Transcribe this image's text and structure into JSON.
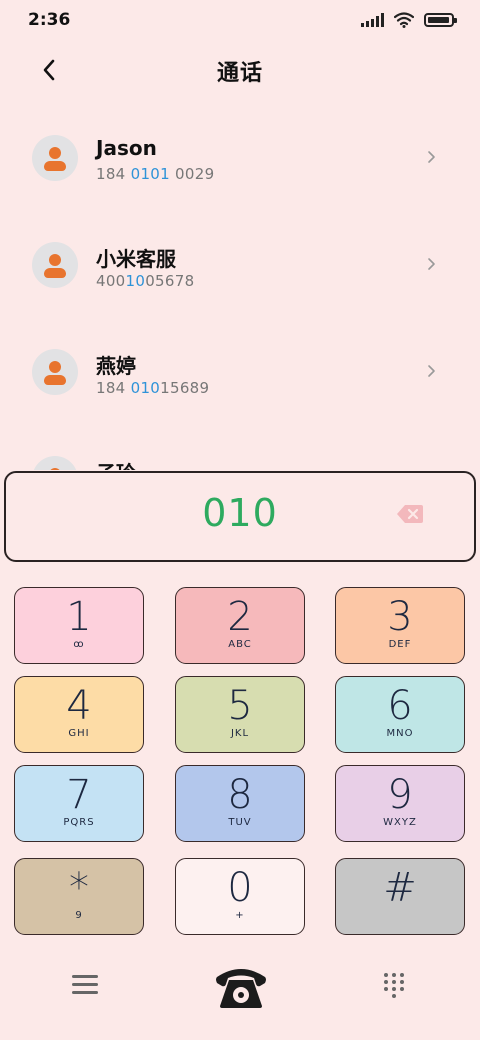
{
  "status_bar": {
    "time": "2:36"
  },
  "header": {
    "title": "通话",
    "back_icon": "chevron-left-icon"
  },
  "contacts": [
    {
      "name": "Jason",
      "number_parts": [
        "184 ",
        "0101",
        " 0029"
      ]
    },
    {
      "name": "小米客服",
      "number_parts": [
        "400",
        "10",
        "05678"
      ]
    },
    {
      "name": "燕婷",
      "number_parts": [
        "184 ",
        "010",
        "15689"
      ]
    },
    {
      "name": "子玲",
      "number_parts": [
        "",
        "",
        ""
      ]
    }
  ],
  "dial_input": {
    "value": "010",
    "color": "#2eaa5f",
    "backspace_icon": "backspace-icon"
  },
  "keypad": [
    {
      "digit": "1",
      "letters": "ꝏ",
      "color": "#fdd0dc"
    },
    {
      "digit": "2",
      "letters": "ABC",
      "color": "#f6b9bb"
    },
    {
      "digit": "3",
      "letters": "DEF",
      "color": "#fcc7a6"
    },
    {
      "digit": "4",
      "letters": "GHI",
      "color": "#fddca6"
    },
    {
      "digit": "5",
      "letters": "JKL",
      "color": "#d7ddb0"
    },
    {
      "digit": "6",
      "letters": "MNO",
      "color": "#bfe6e6"
    },
    {
      "digit": "7",
      "letters": "PQRS",
      "color": "#c4e2f4"
    },
    {
      "digit": "8",
      "letters": "TUV",
      "color": "#b3c7ec"
    },
    {
      "digit": "9",
      "letters": "WXYZ",
      "color": "#e8cfe7"
    },
    {
      "digit": "*",
      "letters": "9",
      "color": "#d5c2a6"
    },
    {
      "digit": "0",
      "letters": "+",
      "color": "#fdf1f0"
    },
    {
      "digit": "#",
      "letters": "",
      "color": "#c6c6c6"
    }
  ],
  "bottom_nav": {
    "menu_icon": "menu-icon",
    "call_icon": "phone-icon",
    "keypad_icon": "dialpad-icon"
  }
}
